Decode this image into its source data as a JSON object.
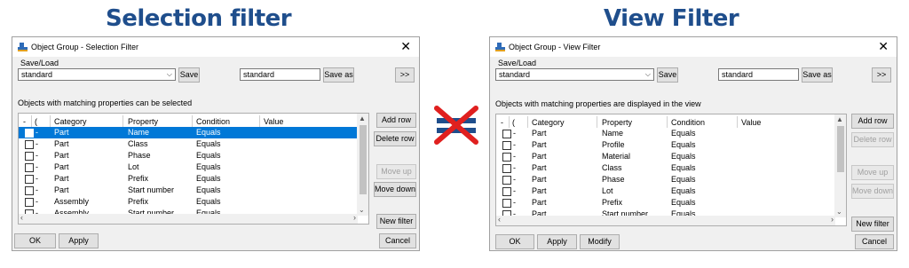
{
  "headings": {
    "left": "Selection filter",
    "right": "View Filter"
  },
  "colors": {
    "heading": "#1f4e8c",
    "selection": "#0078d7",
    "cross": "#e0201f",
    "equals_bars": "#1f4e8c"
  },
  "selection_dialog": {
    "title": "Object Group - Selection Filter",
    "save_load_label": "Save/Load",
    "combo_value": "standard",
    "save_label": "Save",
    "name_value": "standard",
    "save_as_label": "Save as",
    "expand_label": ">>",
    "info": "Objects with matching properties can be selected",
    "columns": [
      "-",
      "(",
      "Category",
      "Property",
      "Condition",
      "Value"
    ],
    "rows": [
      {
        "dash": "-",
        "category": "Part",
        "property": "Name",
        "condition": "Equals",
        "selected": true
      },
      {
        "dash": "-",
        "category": "Part",
        "property": "Class",
        "condition": "Equals"
      },
      {
        "dash": "-",
        "category": "Part",
        "property": "Phase",
        "condition": "Equals"
      },
      {
        "dash": "-",
        "category": "Part",
        "property": "Lot",
        "condition": "Equals"
      },
      {
        "dash": "-",
        "category": "Part",
        "property": "Prefix",
        "condition": "Equals"
      },
      {
        "dash": "-",
        "category": "Part",
        "property": "Start number",
        "condition": "Equals"
      },
      {
        "dash": "-",
        "category": "Assembly",
        "property": "Prefix",
        "condition": "Equals"
      },
      {
        "dash": "-",
        "category": "Assembly",
        "property": "Start number",
        "condition": "Equals"
      }
    ],
    "side_buttons": {
      "add_row": "Add row",
      "delete_row": "Delete row",
      "move_up": "Move up",
      "move_down": "Move down",
      "new_filter": "New filter"
    },
    "bottom": {
      "ok": "OK",
      "apply": "Apply",
      "cancel": "Cancel"
    }
  },
  "view_dialog": {
    "title": "Object Group - View Filter",
    "save_load_label": "Save/Load",
    "combo_value": "standard",
    "save_label": "Save",
    "name_value": "standard",
    "save_as_label": "Save as",
    "expand_label": ">>",
    "info": "Objects with matching properties are displayed in the view",
    "columns": [
      "-",
      "(",
      "Category",
      "Property",
      "Condition",
      "Value"
    ],
    "rows": [
      {
        "dash": "-",
        "category": "Part",
        "property": "Name",
        "condition": "Equals"
      },
      {
        "dash": "-",
        "category": "Part",
        "property": "Profile",
        "condition": "Equals"
      },
      {
        "dash": "-",
        "category": "Part",
        "property": "Material",
        "condition": "Equals"
      },
      {
        "dash": "-",
        "category": "Part",
        "property": "Class",
        "condition": "Equals"
      },
      {
        "dash": "-",
        "category": "Part",
        "property": "Phase",
        "condition": "Equals"
      },
      {
        "dash": "-",
        "category": "Part",
        "property": "Lot",
        "condition": "Equals"
      },
      {
        "dash": "-",
        "category": "Part",
        "property": "Prefix",
        "condition": "Equals"
      },
      {
        "dash": "-",
        "category": "Part",
        "property": "Start number",
        "condition": "Equals"
      }
    ],
    "side_buttons": {
      "add_row": "Add row",
      "delete_row": "Delete row",
      "move_up": "Move up",
      "move_down": "Move down",
      "new_filter": "New filter"
    },
    "bottom": {
      "ok": "OK",
      "apply": "Apply",
      "modify": "Modify",
      "cancel": "Cancel"
    }
  }
}
